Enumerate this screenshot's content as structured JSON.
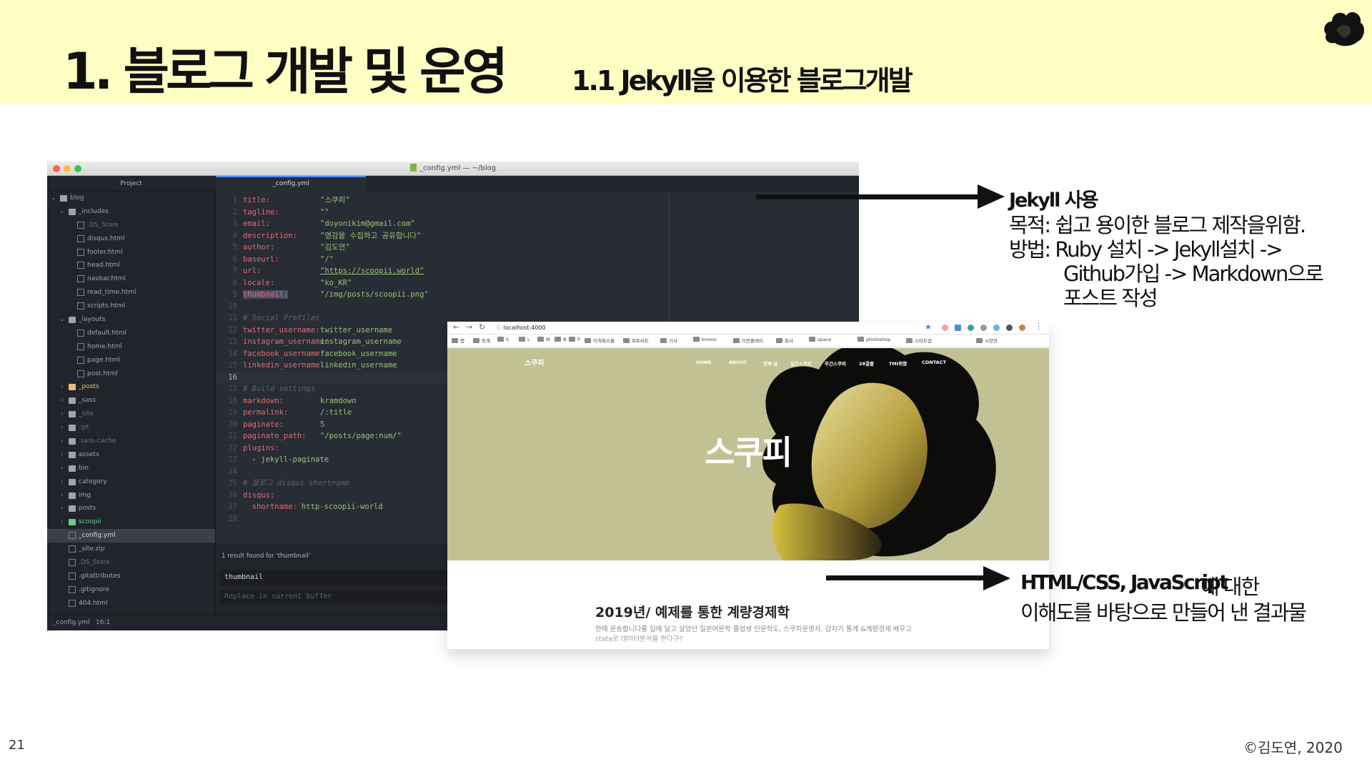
{
  "slide": {
    "title": "1. 블로그 개발 및 운영",
    "subtitle": "1.1   Jekyll을 이용한 블로그개발",
    "page_number": "21",
    "copyright": "©김도연, 2020",
    "logo_icon": "cloud-logo-icon"
  },
  "editor": {
    "window_title": "_config.yml — ~/blog",
    "project_label": "Project",
    "tab_label": "_config.yml",
    "tree": [
      {
        "label": "blog",
        "type": "folder",
        "depth": 0,
        "open": true
      },
      {
        "label": "_includes",
        "type": "folder",
        "depth": 1,
        "open": true
      },
      {
        "label": ".DS_Store",
        "type": "file",
        "depth": 2,
        "dim": true
      },
      {
        "label": "disqus.html",
        "type": "file",
        "depth": 2
      },
      {
        "label": "footer.html",
        "type": "file",
        "depth": 2
      },
      {
        "label": "head.html",
        "type": "file",
        "depth": 2
      },
      {
        "label": "navbar.html",
        "type": "file",
        "depth": 2
      },
      {
        "label": "read_time.html",
        "type": "file",
        "depth": 2
      },
      {
        "label": "scripts.html",
        "type": "file",
        "depth": 2
      },
      {
        "label": "_layouts",
        "type": "folder",
        "depth": 1,
        "open": true
      },
      {
        "label": "default.html",
        "type": "file",
        "depth": 2
      },
      {
        "label": "home.html",
        "type": "file",
        "depth": 2
      },
      {
        "label": "page.html",
        "type": "file",
        "depth": 2
      },
      {
        "label": "post.html",
        "type": "file",
        "depth": 2
      },
      {
        "label": "_posts",
        "type": "folder",
        "depth": 1,
        "open": false,
        "color": "yellow"
      },
      {
        "label": "_sass",
        "type": "folder",
        "depth": 1,
        "open": false
      },
      {
        "label": "_site",
        "type": "folder",
        "depth": 1,
        "open": false,
        "dim": true
      },
      {
        "label": ".git",
        "type": "folder",
        "depth": 1,
        "open": false,
        "dim": true
      },
      {
        "label": ".sass-cache",
        "type": "folder",
        "depth": 1,
        "open": false,
        "dim": true
      },
      {
        "label": "assets",
        "type": "folder",
        "depth": 1,
        "open": false
      },
      {
        "label": "bin",
        "type": "folder",
        "depth": 1,
        "open": false
      },
      {
        "label": "category",
        "type": "folder",
        "depth": 1,
        "open": false
      },
      {
        "label": "img",
        "type": "folder",
        "depth": 1,
        "open": false
      },
      {
        "label": "posts",
        "type": "folder",
        "depth": 1,
        "open": false
      },
      {
        "label": "scoopii",
        "type": "folder",
        "depth": 1,
        "open": false,
        "color": "green"
      },
      {
        "label": "_config.yml",
        "type": "file",
        "depth": 1,
        "active": true
      },
      {
        "label": "_site.zip",
        "type": "file",
        "depth": 1
      },
      {
        "label": ".DS_Store",
        "type": "file",
        "depth": 1,
        "dim": true
      },
      {
        "label": ".gitattributes",
        "type": "file",
        "depth": 1
      },
      {
        "label": ".gitignore",
        "type": "file",
        "depth": 1
      },
      {
        "label": "404.html",
        "type": "file",
        "depth": 1
      }
    ],
    "code_lines": [
      {
        "n": "1",
        "key": "title:",
        "value": "\"스쿠피\"",
        "vtype": "s"
      },
      {
        "n": "2",
        "key": "tagline:",
        "value": "\"\"",
        "vtype": "s"
      },
      {
        "n": "3",
        "key": "email:",
        "value": "\"doyonikim@gmail.com\"",
        "vtype": "s"
      },
      {
        "n": "4",
        "key": "description:",
        "value": "\"영감을 수집하고 공유합니다\"",
        "vtype": "s"
      },
      {
        "n": "5",
        "key": "author:",
        "value": "\"김도연\"",
        "vtype": "s"
      },
      {
        "n": "6",
        "key": "baseurl:",
        "value": "\"/\"",
        "vtype": "s"
      },
      {
        "n": "7",
        "key": "url:",
        "value": "\"https://scoopii.world\"",
        "vtype": "url"
      },
      {
        "n": "8",
        "key": "locale:",
        "value": "\"ko_KR\"",
        "vtype": "s"
      },
      {
        "n": "9",
        "key": "thumbnail:",
        "value": "\"/img/posts/scoopii.png\"",
        "vtype": "s",
        "highlight": true
      },
      {
        "n": "10",
        "key": "",
        "value": "",
        "vtype": "s"
      },
      {
        "n": "11",
        "comment": "# Social Profiles"
      },
      {
        "n": "12",
        "key": "twitter_username:",
        "value": "twitter_username",
        "vtype": "s"
      },
      {
        "n": "13",
        "key": "instagram_username:",
        "value": "instagram_username",
        "vtype": "s"
      },
      {
        "n": "14",
        "key": "facebook_username:",
        "value": "facebook_username",
        "vtype": "s"
      },
      {
        "n": "15",
        "key": "linkedin_username:",
        "value": "linkedin_username",
        "vtype": "s"
      },
      {
        "n": "16",
        "key": "",
        "value": "",
        "vtype": "s",
        "current": true
      },
      {
        "n": "17",
        "comment": "# Build settings"
      },
      {
        "n": "18",
        "key": "markdown:",
        "value": "kramdown",
        "vtype": "s"
      },
      {
        "n": "19",
        "key": "permalink:",
        "value": "/:title",
        "vtype": "s"
      },
      {
        "n": "20",
        "key": "paginate:",
        "value": "5",
        "vtype": "n"
      },
      {
        "n": "21",
        "key": "paginate_path:",
        "value": "\"/posts/page:num/\"",
        "vtype": "s"
      },
      {
        "n": "22",
        "key": "plugins:",
        "value": "",
        "vtype": "s"
      },
      {
        "n": "23",
        "indent": "  - ",
        "value": "jekyll-paginate",
        "vtype": "s",
        "list": true
      },
      {
        "n": "24",
        "key": "",
        "value": "",
        "vtype": "s"
      },
      {
        "n": "25",
        "comment": "# 블로그 disqus shortname"
      },
      {
        "n": "26",
        "key": "disqus:",
        "value": "",
        "vtype": "s"
      },
      {
        "n": "27",
        "indent": "  ",
        "key": "shortname:",
        "value": "http-scoopii-world",
        "vtype": "s",
        "nested": true
      },
      {
        "n": "28",
        "key": "",
        "value": "",
        "vtype": "s"
      }
    ],
    "find": {
      "result_text": "1 result found for 'thumbnail'",
      "query": "thumbnail",
      "replace_placeholder": "Replace in current buffer"
    },
    "status": {
      "file": "_config.yml",
      "cursor": "16:1"
    }
  },
  "browser": {
    "url": "localhost:4000",
    "bookmarks": [
      "앱",
      "동계",
      "S",
      "L",
      "M",
      "B",
      "P",
      "이게뭐스쿨",
      "위토비트",
      "기사",
      "kmooc",
      "이번플레이",
      "회사",
      "space",
      "photoshop",
      "스타트업",
      "시찬연"
    ],
    "site": {
      "brand": "스쿠피",
      "nav": [
        "HOME",
        "ABOUT",
        "전체 글",
        "일간스쿠피",
        "주간스쿠피",
        "28결들",
        "TMI취향",
        "CONTACT"
      ],
      "hero_title": "스쿠피",
      "post_title": "2019년/ 예제를 통한 계량경제학",
      "post_desc": "한때 문송합니다를 입에 달고 살았던 일본어문학 졸업생 인문학도, 스쿠피운영자. 갑자기 통계 &계량경제 배우고 stata로 데이터분석을 한다구?"
    },
    "colors": {
      "hero_bg": "#c2c193"
    }
  },
  "annotations": {
    "a1": {
      "heading": "Jekyll 사용",
      "line1": "목적:   쉽고 용이한 블로그 제작을위함.",
      "line2": "방법:   Ruby 설치 -> Jekyll설치 ->",
      "line3": "Github가입 -> Markdown으로",
      "line4": "포스트 작성"
    },
    "a2": {
      "bold": "HTML/CSS, JavaScript",
      "rest": "에 대한",
      "line2": "이해도를 바탕으로 만들어 낸 결과물"
    }
  }
}
